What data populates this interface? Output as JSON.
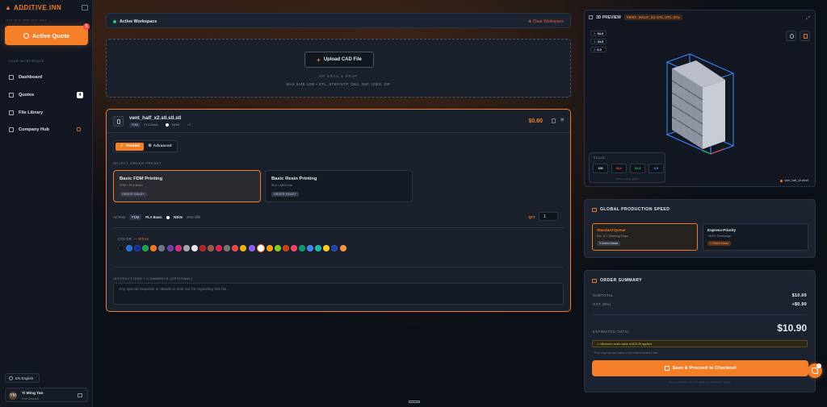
{
  "app": {
    "brand": "ADDITIVE INN",
    "tagline": "DREAM · BUILD · GROW",
    "sysline": "v1.4.8 · 46 ms · 30/05 · 10:18 · EPS 0",
    "active_quote_label": "Active Quote",
    "active_quote_badge": "1"
  },
  "sidebar": {
    "section_label": "YOUR WORKSPACE",
    "items": [
      {
        "label": "Dashboard",
        "icon": "grid-icon"
      },
      {
        "label": "Quotes",
        "icon": "quote-icon",
        "count": "4"
      },
      {
        "label": "File Library",
        "icon": "folder-icon"
      },
      {
        "label": "Company Hub",
        "icon": "building-icon",
        "locked": true
      }
    ],
    "language": "EN   English",
    "user": {
      "initials": "YM",
      "name": "Yi Ming Tan",
      "account": "Free Account"
    }
  },
  "workspace": {
    "title": "Active Workspace",
    "clear_label": "Clear Workspace"
  },
  "upload": {
    "button_label": "Upload CAD File",
    "or_drag": "OR DRAG & DROP",
    "limits": "MAX SIZE 1GB • STL, STEP/STP, OBJ, 3MF, IGES, ZIP"
  },
  "file": {
    "name": "vent_half_x2.stl.stl.stl",
    "tech": "FDM",
    "material": "PLA Basic",
    "color": "White",
    "qty_text": "×1",
    "price": "$0.60",
    "tabs": {
      "presets": "Presets",
      "advanced": "Advanced"
    },
    "select_preset_label": "SELECT ORDER PRESET",
    "presets": [
      {
        "title": "Basic FDM Printing",
        "subtitle": "FDM • PLA Basic",
        "badge": "ORDER READY"
      },
      {
        "title": "Basic Resin Printing",
        "subtitle": "SLA • ABS-Like",
        "badge": "ORDER READY"
      }
    ],
    "active": {
      "label": "ACTIVE",
      "tech": "FDM",
      "material": "PLA Basic",
      "color": "White",
      "infill": "20% infill"
    },
    "qty_label": "QTY",
    "qty_value": "1",
    "color_label": "COLOR",
    "color_selected": "White",
    "colors": [
      "#111318",
      "#1f6fd6",
      "#0f2b9b",
      "#16a34a",
      "#f97316",
      "#6b7280",
      "#6b3fa0",
      "#db2777",
      "#a3a3a3",
      "#e5e7eb",
      "#b91c1c",
      "#9b5a3c",
      "#e11d48",
      "#78716c",
      "#ef4444",
      "#eab308",
      "#8b5cf6",
      "#ffffff",
      "#f59e0b",
      "#84cc16",
      "#c2410c",
      "#f43f5e",
      "#059669",
      "#3b82f6",
      "#14b8a6",
      "#facc15",
      "#1e40af",
      "#fb923c"
    ],
    "instructions_label": "INSTRUCTIONS / COMMENTS (OPTIONAL)",
    "instructions_placeholder": "Any special requests or details to look out for regarding this file..."
  },
  "preview": {
    "title": "3D PREVIEW",
    "file_tag": "VENT_HALF_X2.STL.STL.STL",
    "dims": [
      {
        "axis": "X",
        "value": "54.0",
        "color": "#ef4444"
      },
      {
        "axis": "Y",
        "value": "34.5",
        "color": "#22c55e"
      },
      {
        "axis": "Z",
        "value": "6.0",
        "color": "#3b82f6"
      }
    ],
    "scale_label": "SCALE",
    "scale_values": [
      "100",
      "54.0",
      "34.5",
      "6.0"
    ],
    "scale_hint": "Uniform scaling applied",
    "legend": "vent_half_x2.stl.stl"
  },
  "speed": {
    "title": "GLOBAL PRODUCTION SPEED",
    "options": [
      {
        "title": "Standard Queue",
        "subtitle": "Est. 5-7 Working Days",
        "badge": "3 Orders Ahead"
      },
      {
        "title": "Express Priority",
        "subtitle": "+50% Surcharge",
        "badge": "1 Orders Ahead"
      }
    ]
  },
  "summary": {
    "title": "ORDER SUMMARY",
    "subtotal_label": "SUBTOTAL",
    "subtotal": "$10.00",
    "gst_label": "GST (9%)",
    "gst": "+$0.90",
    "total_label": "ESTIMATED TOTAL",
    "total": "$10.90",
    "min_notice": "Minimum order value of $10.00 applied",
    "note": "* Price may fluctuate based on the material finalized later",
    "checkout_label": "Save & Proceed to Checkout",
    "secure": "Secure checkout · No card details are saved after signing"
  },
  "colors": {
    "accent": "#f47f28",
    "panel": "#1b2230",
    "bg": "#0b0f17"
  }
}
